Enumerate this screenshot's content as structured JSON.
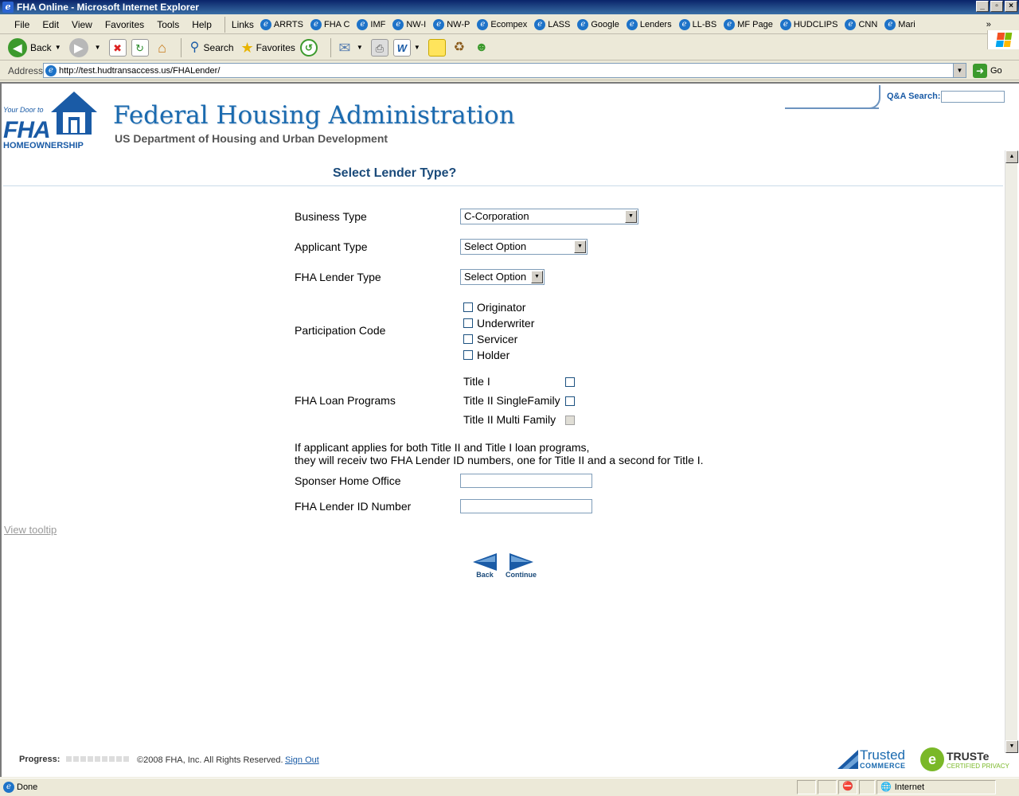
{
  "window": {
    "title": "FHA Online - Microsoft Internet Explorer",
    "buttons": [
      "_",
      "▫",
      "×"
    ]
  },
  "menu": [
    "File",
    "Edit",
    "View",
    "Favorites",
    "Tools",
    "Help"
  ],
  "links": {
    "label": "Links",
    "items": [
      "ARRTS",
      "FHA C",
      "IMF",
      "NW-I",
      "NW-P",
      "Ecompex",
      "LASS",
      "Google",
      "Lenders",
      "LL-BS",
      "MF Page",
      "HUDCLIPS",
      "CNN",
      "Mari"
    ],
    "more": "»"
  },
  "toolbar": {
    "back": "Back",
    "search": "Search",
    "favorites": "Favorites"
  },
  "address": {
    "label": "Address",
    "url": "http://test.hudtransaccess.us/FHALender/",
    "go": "Go"
  },
  "header": {
    "logo_door": "Your Door to",
    "logo_fha": "FHA",
    "logo_home": "HOMEOWNERSHIP",
    "title": "Federal Housing Administration",
    "subtitle": "US Department of Housing and Urban Development",
    "qa_label": "Q&A Search:",
    "qa_value": ""
  },
  "form": {
    "page_title": "Select Lender Type?",
    "business_type_label": "Business Type",
    "business_type_value": "C-Corporation",
    "applicant_type_label": "Applicant Type",
    "applicant_type_value": "Select Option",
    "lender_type_label": "FHA Lender Type",
    "lender_type_value": "Select Option",
    "participation_label": "Participation Code",
    "participation_options": [
      {
        "label": "Originator",
        "checked": false
      },
      {
        "label": "Underwriter",
        "checked": false
      },
      {
        "label": "Servicer",
        "checked": false
      },
      {
        "label": "Holder",
        "checked": false
      }
    ],
    "loan_programs_label": "FHA Loan Programs",
    "loan_programs": [
      {
        "label": "Title I",
        "checked": false,
        "disabled": false
      },
      {
        "label": "Title II SingleFamily",
        "checked": false,
        "disabled": false
      },
      {
        "label": "Title II Multi Family",
        "checked": false,
        "disabled": true
      }
    ],
    "note_line1": "If applicant applies for both Title II and Title I loan programs,",
    "note_line2": "they will receiv two FHA Lender ID numbers, one for Title II and a second for Title I.",
    "sponsor_label": "Sponser Home Office",
    "sponsor_value": "",
    "lender_id_label": "FHA Lender ID Number",
    "lender_id_value": "",
    "tooltip_link": "View tooltip",
    "back_label": "Back",
    "continue_label": "Continue"
  },
  "footer": {
    "progress_label": "Progress:",
    "copyright": "©2008 FHA, Inc. All Rights Reserved.",
    "sign_out": "Sign Out",
    "trusted_1": "Trusted",
    "trusted_2": "COMMERCE",
    "truste_1": "TRUSTe",
    "truste_2": "CERTIFIED PRIVACY"
  },
  "status": {
    "text": "Done",
    "zone": "Internet"
  },
  "icons": {
    "back": "back-arrow-icon",
    "forward": "forward-arrow-icon",
    "stop": "stop-icon",
    "refresh": "refresh-icon",
    "home": "home-icon",
    "search": "search-icon",
    "favorites": "star-icon",
    "history": "history-icon",
    "mail": "mail-icon",
    "print": "print-icon",
    "edit": "word-icon",
    "notes": "note-icon",
    "research": "research-icon",
    "messenger": "messenger-icon"
  },
  "colors": {
    "brand_blue": "#1a6aaf",
    "title_blue": "#1a4a7a",
    "link_blue": "#1a5ba6"
  }
}
